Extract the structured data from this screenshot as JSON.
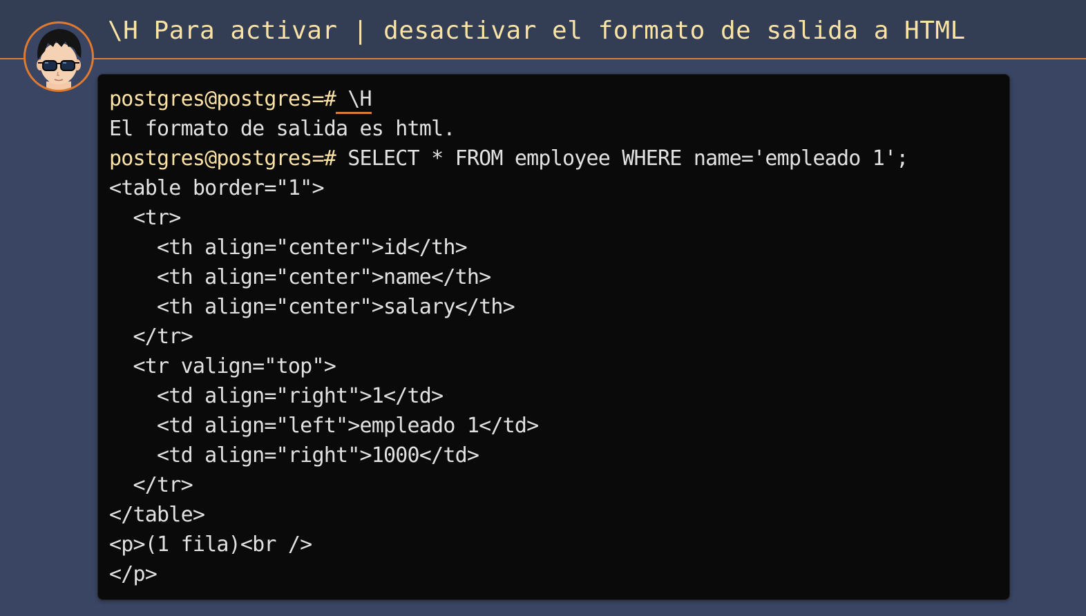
{
  "slide": {
    "title": "\\H Para activar | desactivar el formato de salida a HTML"
  },
  "colors": {
    "accent": "#e07a2e",
    "prompt": "#fbe3a6",
    "terminal_bg": "#0a0a0a",
    "page_bg": "#3a4563"
  },
  "avatar": {
    "icon": "cartoon-face-with-sunglasses-icon"
  },
  "terminal": {
    "prompt": "postgres@postgres=#",
    "command_1": " \\H",
    "output_1": "El formato de salida es html.",
    "command_2": " SELECT * FROM employee WHERE name='empleado 1';",
    "output_lines": [
      "<table border=\"1\">",
      "  <tr>",
      "    <th align=\"center\">id</th>",
      "    <th align=\"center\">name</th>",
      "    <th align=\"center\">salary</th>",
      "  </tr>",
      "  <tr valign=\"top\">",
      "    <td align=\"right\">1</td>",
      "    <td align=\"left\">empleado 1</td>",
      "    <td align=\"right\">1000</td>",
      "  </tr>",
      "</table>",
      "<p>(1 fila)<br />",
      "</p>"
    ]
  }
}
